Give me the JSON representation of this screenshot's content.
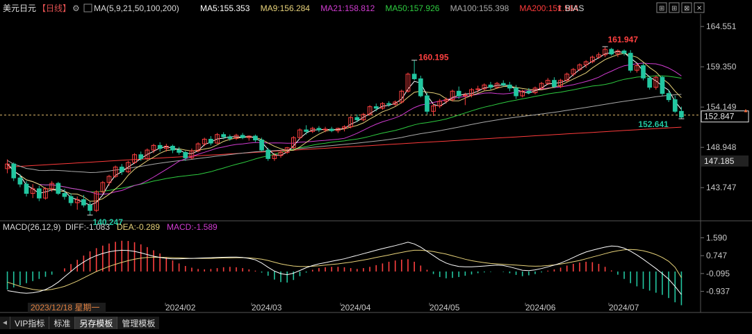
{
  "header": {
    "symbol": "美元日元",
    "period": "【日线】",
    "ma_label": "MA(5,9,21,50,100,200)",
    "ma_items": [
      {
        "text": "MA5:155.353",
        "color": "#ffffff"
      },
      {
        "text": "MA9:156.284",
        "color": "#e8d37a"
      },
      {
        "text": "MA21:158.812",
        "color": "#d23cd2"
      },
      {
        "text": "MA50:157.926",
        "color": "#2ecc40"
      },
      {
        "text": "MA100:155.398",
        "color": "#aaaaaa"
      },
      {
        "text": "MA200:151.564",
        "color": "#ff3b3b"
      }
    ],
    "bias_label": "BIAS"
  },
  "price_axis": {
    "ticks": [
      "164.551",
      "159.350",
      "154.149",
      "148.948",
      "143.747"
    ],
    "current_price": "152.847",
    "cursor_price": "147.185"
  },
  "annotations": {
    "high_1": "160.195",
    "high_2": "161.947",
    "low_1": "140.247",
    "low_2": "152.641"
  },
  "macd": {
    "label": "MACD(26,12,9)",
    "diff": "DIFF:-1.083",
    "dea": "DEA:-0.289",
    "macd": "MACD:-1.589",
    "ticks": [
      "1.590",
      "0.747",
      "-0.095",
      "-0.937"
    ]
  },
  "time_axis": {
    "cursor_date": "2023/12/18 星期一",
    "labels": [
      "2024/02",
      "2024/03",
      "2024/04",
      "2024/05",
      "2024/06",
      "2024/07"
    ]
  },
  "tabs": [
    "VIP指标",
    "标准",
    "另存模板",
    "管理模板"
  ],
  "colors": {
    "up": "#ff4040",
    "down": "#22c6a0",
    "ma5": "#ffffff",
    "ma9": "#e8d37a",
    "ma21": "#d23cd2",
    "ma50": "#2ecc40",
    "ma100": "#aaaaaa",
    "ma200": "#ff3b3b",
    "macd_diff": "#ffffff",
    "macd_dea": "#e8d37a",
    "axis_text": "#c8c8c8",
    "annotation_high": "#ff4040",
    "annotation_low": "#22c6a0"
  },
  "chart_data": {
    "type": "candlestick",
    "price_range": [
      140.0,
      166.0
    ],
    "ma200_range": [
      146.4,
      151.56
    ],
    "candles": [
      [
        146.2,
        147.4,
        145.6,
        146.8
      ],
      [
        146.8,
        147.0,
        144.6,
        145.0
      ],
      [
        145.0,
        145.5,
        143.8,
        144.2
      ],
      [
        144.2,
        144.6,
        142.6,
        143.0
      ],
      [
        143.0,
        144.2,
        142.4,
        143.6
      ],
      [
        143.6,
        144.0,
        142.0,
        142.4
      ],
      [
        142.4,
        143.8,
        142.2,
        143.6
      ],
      [
        143.6,
        144.6,
        143.2,
        144.3
      ],
      [
        144.3,
        144.5,
        142.8,
        143.0
      ],
      [
        143.0,
        143.6,
        142.2,
        142.6
      ],
      [
        142.6,
        143.0,
        141.4,
        141.8
      ],
      [
        141.8,
        142.6,
        140.9,
        142.2
      ],
      [
        142.2,
        142.8,
        141.2,
        141.5
      ],
      [
        141.5,
        141.9,
        140.2,
        140.8
      ],
      [
        140.8,
        143.4,
        140.6,
        143.2
      ],
      [
        143.2,
        144.6,
        143.0,
        144.4
      ],
      [
        144.4,
        145.4,
        144.0,
        145.2
      ],
      [
        145.2,
        146.6,
        145.0,
        146.4
      ],
      [
        146.4,
        146.8,
        145.4,
        145.8
      ],
      [
        145.8,
        147.2,
        145.6,
        147.0
      ],
      [
        147.0,
        148.2,
        146.8,
        148.0
      ],
      [
        148.0,
        148.4,
        147.2,
        147.5
      ],
      [
        147.5,
        148.8,
        147.3,
        148.6
      ],
      [
        148.6,
        149.4,
        148.2,
        149.2
      ],
      [
        149.2,
        149.6,
        148.4,
        148.8
      ],
      [
        148.8,
        149.4,
        148.4,
        149.1
      ],
      [
        149.1,
        149.3,
        148.2,
        148.6
      ],
      [
        148.6,
        149.0,
        148.0,
        148.3
      ],
      [
        148.3,
        148.5,
        147.2,
        147.6
      ],
      [
        147.6,
        148.8,
        147.4,
        148.5
      ],
      [
        148.5,
        149.6,
        148.3,
        149.4
      ],
      [
        149.4,
        150.2,
        149.1,
        150.0
      ],
      [
        150.0,
        150.4,
        149.2,
        149.5
      ],
      [
        149.5,
        150.8,
        149.4,
        150.6
      ],
      [
        150.6,
        150.9,
        150.0,
        150.3
      ],
      [
        150.3,
        150.6,
        149.8,
        150.1
      ],
      [
        150.1,
        150.7,
        149.9,
        150.5
      ],
      [
        150.5,
        150.8,
        150.0,
        150.2
      ],
      [
        150.2,
        150.5,
        149.8,
        150.4
      ],
      [
        150.4,
        150.6,
        149.6,
        149.9
      ],
      [
        149.9,
        150.2,
        148.4,
        148.6
      ],
      [
        148.6,
        148.9,
        147.2,
        147.5
      ],
      [
        147.5,
        148.2,
        147.2,
        147.9
      ],
      [
        147.9,
        148.6,
        147.6,
        148.3
      ],
      [
        148.3,
        149.0,
        148.1,
        148.9
      ],
      [
        148.9,
        150.4,
        148.7,
        150.2
      ],
      [
        150.2,
        151.4,
        150.0,
        151.2
      ],
      [
        151.2,
        151.8,
        150.6,
        151.0
      ],
      [
        151.0,
        151.6,
        150.8,
        151.4
      ],
      [
        151.4,
        151.7,
        150.9,
        151.2
      ],
      [
        151.2,
        151.6,
        150.9,
        151.3
      ],
      [
        151.3,
        151.6,
        150.9,
        151.1
      ],
      [
        151.1,
        151.5,
        150.8,
        151.4
      ],
      [
        151.4,
        151.8,
        151.0,
        151.6
      ],
      [
        151.6,
        153.0,
        151.4,
        152.8
      ],
      [
        152.8,
        153.2,
        152.2,
        152.5
      ],
      [
        152.5,
        153.4,
        152.3,
        153.2
      ],
      [
        153.2,
        154.4,
        153.0,
        154.2
      ],
      [
        154.2,
        154.6,
        153.6,
        154.0
      ],
      [
        154.0,
        154.8,
        153.8,
        154.6
      ],
      [
        154.6,
        154.9,
        154.2,
        154.5
      ],
      [
        154.5,
        155.0,
        154.3,
        154.8
      ],
      [
        154.8,
        156.4,
        154.6,
        156.2
      ],
      [
        156.2,
        158.6,
        156.0,
        158.4
      ],
      [
        158.4,
        160.195,
        157.6,
        157.8
      ],
      [
        157.8,
        158.2,
        155.4,
        155.6
      ],
      [
        155.6,
        156.0,
        153.2,
        153.6
      ],
      [
        153.6,
        154.6,
        153.0,
        154.3
      ],
      [
        154.3,
        155.2,
        154.0,
        154.9
      ],
      [
        154.9,
        155.4,
        154.6,
        155.1
      ],
      [
        155.1,
        156.4,
        154.9,
        156.2
      ],
      [
        156.2,
        156.8,
        155.2,
        155.6
      ],
      [
        155.6,
        156.0,
        154.4,
        155.7
      ],
      [
        155.7,
        156.6,
        155.4,
        156.4
      ],
      [
        156.4,
        156.9,
        156.0,
        156.5
      ],
      [
        156.5,
        157.2,
        156.3,
        157.0
      ],
      [
        157.0,
        157.4,
        156.4,
        156.7
      ],
      [
        156.7,
        157.4,
        156.5,
        157.2
      ],
      [
        157.2,
        157.6,
        156.8,
        157.0
      ],
      [
        157.0,
        157.4,
        156.2,
        156.6
      ],
      [
        156.6,
        157.0,
        155.2,
        155.6
      ],
      [
        155.6,
        156.4,
        155.4,
        156.2
      ],
      [
        156.2,
        156.6,
        155.8,
        156.0
      ],
      [
        156.0,
        156.8,
        155.8,
        156.6
      ],
      [
        156.6,
        157.4,
        156.4,
        157.2
      ],
      [
        157.2,
        157.9,
        157.0,
        157.6
      ],
      [
        157.6,
        158.0,
        156.6,
        156.8
      ],
      [
        156.8,
        157.8,
        156.6,
        157.6
      ],
      [
        157.6,
        158.6,
        157.4,
        158.4
      ],
      [
        158.4,
        159.2,
        158.1,
        159.0
      ],
      [
        159.0,
        159.8,
        158.8,
        159.6
      ],
      [
        159.6,
        160.2,
        159.2,
        160.0
      ],
      [
        160.0,
        160.8,
        159.8,
        160.6
      ],
      [
        160.6,
        161.2,
        160.4,
        160.9
      ],
      [
        160.9,
        161.947,
        160.6,
        161.6
      ],
      [
        161.6,
        161.8,
        160.8,
        161.0
      ],
      [
        161.0,
        161.6,
        160.6,
        161.4
      ],
      [
        161.4,
        161.6,
        160.8,
        161.1
      ],
      [
        161.1,
        161.5,
        158.6,
        158.9
      ],
      [
        158.9,
        159.8,
        158.6,
        159.5
      ],
      [
        159.5,
        159.8,
        157.6,
        157.9
      ],
      [
        157.9,
        158.2,
        156.4,
        156.7
      ],
      [
        156.7,
        158.2,
        156.4,
        158.0
      ],
      [
        158.0,
        158.2,
        155.6,
        155.9
      ],
      [
        155.9,
        156.4,
        154.8,
        155.1
      ],
      [
        155.1,
        155.6,
        153.4,
        153.6
      ],
      [
        153.6,
        154.2,
        152.641,
        152.847
      ]
    ],
    "macd_histogram": [
      -0.85,
      -0.75,
      -0.65,
      -0.55,
      -0.45,
      -0.35,
      -0.25,
      -0.15,
      0.0,
      0.15,
      0.35,
      0.55,
      0.75,
      0.95,
      1.1,
      1.22,
      1.32,
      1.4,
      1.45,
      1.44,
      1.38,
      1.28,
      1.15,
      1.0,
      0.85,
      0.68,
      0.52,
      0.38,
      0.26,
      0.18,
      0.12,
      0.1,
      0.12,
      0.16,
      0.2,
      0.22,
      0.2,
      0.16,
      0.1,
      0.04,
      -0.05,
      -0.2,
      -0.38,
      -0.5,
      -0.52,
      -0.4,
      -0.22,
      -0.05,
      0.08,
      0.16,
      0.2,
      0.22,
      0.22,
      0.2,
      0.16,
      0.12,
      0.16,
      0.22,
      0.3,
      0.38,
      0.46,
      0.52,
      0.56,
      0.58,
      0.46,
      0.28,
      0.08,
      -0.12,
      -0.26,
      -0.32,
      -0.3,
      -0.26,
      -0.2,
      -0.14,
      -0.08,
      -0.04,
      -0.02,
      0.0,
      -0.02,
      -0.08,
      -0.16,
      -0.22,
      -0.18,
      -0.12,
      -0.04,
      0.04,
      0.1,
      0.18,
      0.28,
      0.36,
      0.42,
      0.46,
      0.44,
      0.36,
      0.22,
      0.05,
      -0.15,
      -0.35,
      -0.55,
      -0.7,
      -0.82,
      -0.9,
      -1.0,
      -1.1,
      -1.25,
      -1.45,
      -1.589
    ],
    "macd_diff_series": [
      -0.9,
      -0.95,
      -1.0,
      -1.02,
      -1.0,
      -0.95,
      -0.85,
      -0.7,
      -0.5,
      -0.25,
      0.0,
      0.25,
      0.45,
      0.62,
      0.75,
      0.85,
      0.93,
      0.98,
      1.0,
      0.99,
      0.95,
      0.88,
      0.8,
      0.72,
      0.66,
      0.62,
      0.6,
      0.6,
      0.61,
      0.62,
      0.63,
      0.64,
      0.65,
      0.66,
      0.67,
      0.68,
      0.68,
      0.66,
      0.62,
      0.55,
      0.4,
      0.2,
      0.02,
      -0.1,
      -0.15,
      -0.08,
      0.05,
      0.18,
      0.28,
      0.36,
      0.42,
      0.48,
      0.54,
      0.6,
      0.68,
      0.76,
      0.84,
      0.92,
      1.0,
      1.08,
      1.15,
      1.22,
      1.3,
      1.38,
      1.3,
      1.15,
      0.95,
      0.75,
      0.55,
      0.4,
      0.3,
      0.24,
      0.22,
      0.22,
      0.24,
      0.26,
      0.28,
      0.3,
      0.28,
      0.22,
      0.14,
      0.06,
      0.04,
      0.08,
      0.14,
      0.22,
      0.3,
      0.4,
      0.52,
      0.66,
      0.8,
      0.92,
      1.0,
      1.08,
      1.15,
      1.2,
      1.18,
      1.1,
      0.96,
      0.78,
      0.58,
      0.36,
      0.14,
      -0.1,
      -0.36,
      -0.7,
      -1.083
    ],
    "macd_dea_series": [
      -0.5,
      -0.6,
      -0.7,
      -0.78,
      -0.84,
      -0.88,
      -0.88,
      -0.84,
      -0.78,
      -0.7,
      -0.58,
      -0.45,
      -0.3,
      -0.15,
      0.0,
      0.12,
      0.24,
      0.34,
      0.43,
      0.51,
      0.58,
      0.63,
      0.66,
      0.67,
      0.67,
      0.66,
      0.65,
      0.64,
      0.63,
      0.62,
      0.62,
      0.62,
      0.62,
      0.63,
      0.64,
      0.64,
      0.65,
      0.65,
      0.64,
      0.62,
      0.58,
      0.52,
      0.44,
      0.36,
      0.3,
      0.26,
      0.24,
      0.24,
      0.25,
      0.27,
      0.3,
      0.33,
      0.36,
      0.4,
      0.44,
      0.49,
      0.54,
      0.6,
      0.66,
      0.72,
      0.78,
      0.84,
      0.9,
      0.96,
      1.0,
      1.0,
      0.98,
      0.94,
      0.88,
      0.82,
      0.74,
      0.66,
      0.58,
      0.51,
      0.46,
      0.42,
      0.38,
      0.36,
      0.34,
      0.32,
      0.3,
      0.28,
      0.26,
      0.25,
      0.26,
      0.28,
      0.31,
      0.35,
      0.4,
      0.46,
      0.52,
      0.6,
      0.68,
      0.76,
      0.84,
      0.92,
      0.98,
      1.02,
      1.04,
      1.02,
      0.98,
      0.9,
      0.8,
      0.66,
      0.48,
      0.2,
      -0.289
    ]
  }
}
